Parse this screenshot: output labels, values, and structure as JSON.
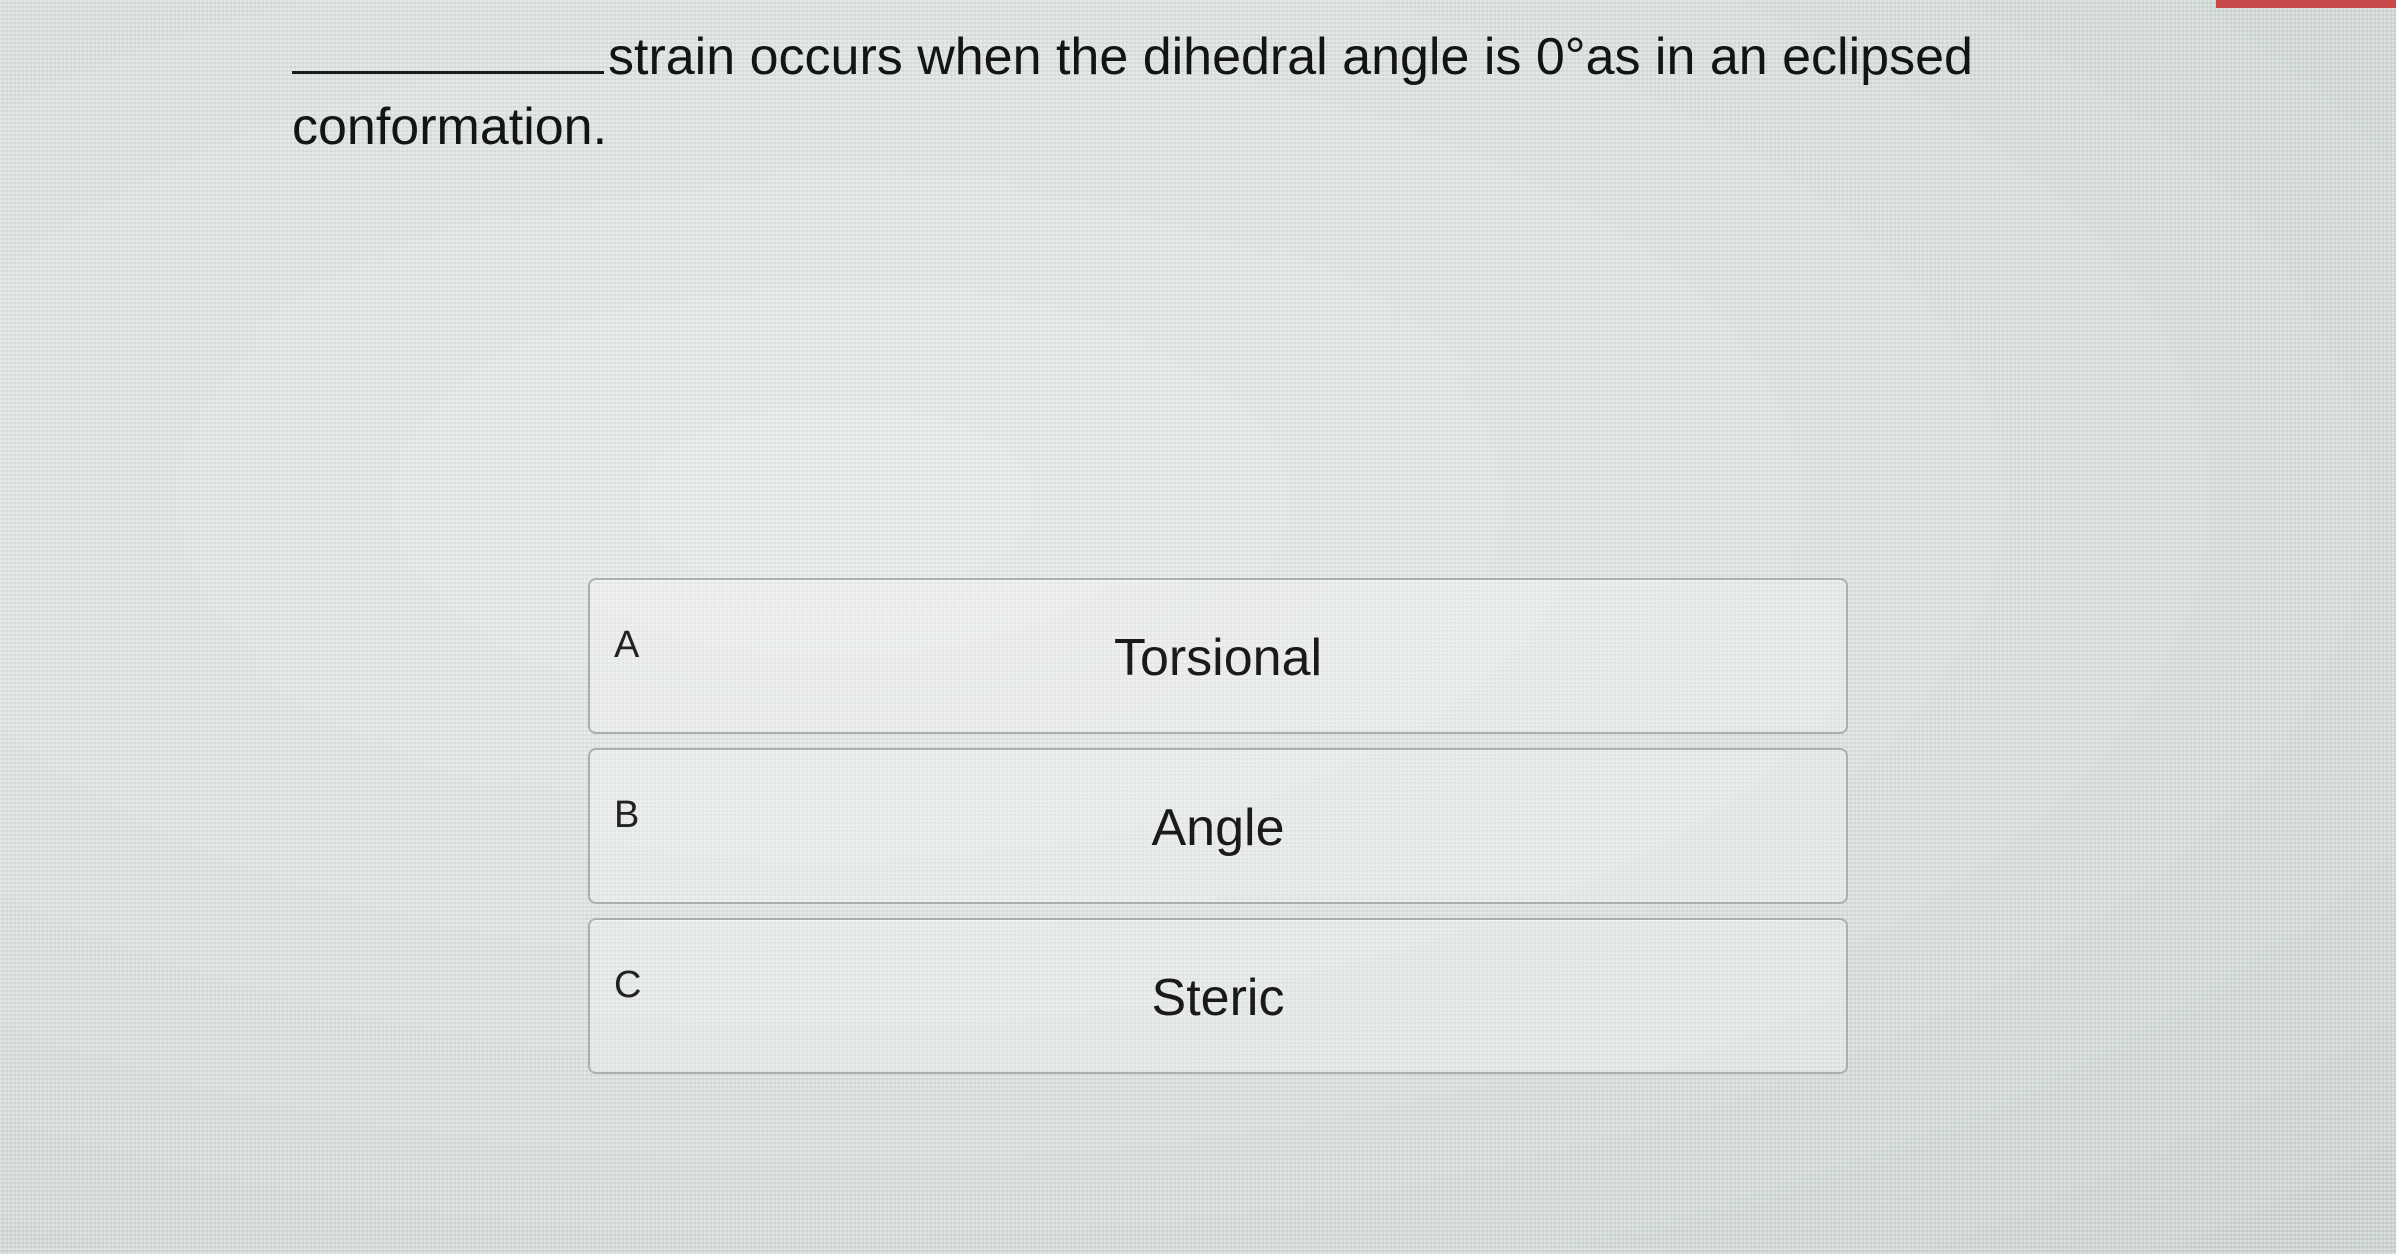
{
  "question": {
    "blank_suffix": "strain occurs when the dihedral angle is 0°as in an eclipsed conformation."
  },
  "options": [
    {
      "letter": "A",
      "text": "Torsional"
    },
    {
      "letter": "B",
      "text": "Angle"
    },
    {
      "letter": "C",
      "text": "Steric"
    }
  ],
  "colors": {
    "background": "#d8dfdd",
    "option_border": "#a9b0ae",
    "accent_strip": "#c84a4a"
  }
}
